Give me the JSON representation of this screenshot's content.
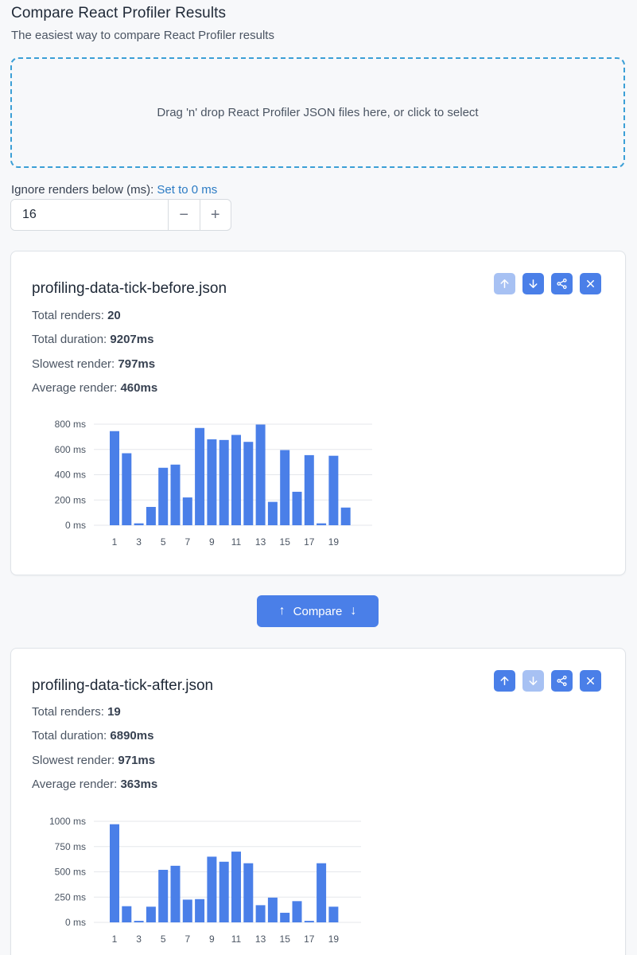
{
  "header": {
    "title": "Compare React Profiler Results",
    "subtitle": "The easiest way to compare React Profiler results"
  },
  "dropzone": {
    "text": "Drag 'n' drop React Profiler JSON files here, or click to select"
  },
  "threshold": {
    "label": "Ignore renders below (ms):",
    "reset_link": "Set to 0 ms",
    "value": "16",
    "minus": "−",
    "plus": "+"
  },
  "compare_button": {
    "label": "Compare",
    "icons": [
      "arrow-up-icon",
      "arrow-down-icon"
    ]
  },
  "colors": {
    "accent": "#4a7fe8",
    "accent_disabled": "#a7c1f3",
    "dropzone_border": "#3b9fd6",
    "link": "#2b7bc4"
  },
  "cards": [
    {
      "filename": "profiling-data-tick-before.json",
      "stats": [
        {
          "label": "Total renders:",
          "value": "20"
        },
        {
          "label": "Total duration:",
          "value": "9207ms"
        },
        {
          "label": "Slowest render:",
          "value": "797ms"
        },
        {
          "label": "Average render:",
          "value": "460ms"
        }
      ],
      "actions": [
        {
          "icon": "arrow-up-icon",
          "disabled": true
        },
        {
          "icon": "arrow-down-icon",
          "disabled": false
        },
        {
          "icon": "share-icon",
          "disabled": false
        },
        {
          "icon": "close-icon",
          "disabled": false
        }
      ]
    },
    {
      "filename": "profiling-data-tick-after.json",
      "stats": [
        {
          "label": "Total renders:",
          "value": "19"
        },
        {
          "label": "Total duration:",
          "value": "6890ms"
        },
        {
          "label": "Slowest render:",
          "value": "971ms"
        },
        {
          "label": "Average render:",
          "value": "363ms"
        }
      ],
      "actions": [
        {
          "icon": "arrow-up-icon",
          "disabled": false
        },
        {
          "icon": "arrow-down-icon",
          "disabled": true
        },
        {
          "icon": "share-icon",
          "disabled": false
        },
        {
          "icon": "close-icon",
          "disabled": false
        }
      ]
    }
  ],
  "chart_data": [
    {
      "type": "bar",
      "categories": [
        "1",
        "2",
        "3",
        "4",
        "5",
        "6",
        "7",
        "8",
        "9",
        "10",
        "11",
        "12",
        "13",
        "14",
        "15",
        "16",
        "17",
        "18",
        "19",
        "20"
      ],
      "tick_labels": [
        "1",
        "3",
        "5",
        "7",
        "9",
        "11",
        "13",
        "15",
        "17",
        "19"
      ],
      "values": [
        745,
        570,
        15,
        145,
        455,
        480,
        220,
        770,
        680,
        675,
        715,
        660,
        797,
        185,
        595,
        265,
        555,
        15,
        550,
        140
      ],
      "yticks": [
        0,
        200,
        400,
        600,
        800
      ],
      "ytick_labels": [
        "0 ms",
        "200 ms",
        "400 ms",
        "600 ms",
        "800 ms"
      ],
      "ylim": [
        0,
        800
      ],
      "grid": true,
      "color": "#4a7fe8"
    },
    {
      "type": "bar",
      "categories": [
        "1",
        "2",
        "3",
        "4",
        "5",
        "6",
        "7",
        "8",
        "9",
        "10",
        "11",
        "12",
        "13",
        "14",
        "15",
        "16",
        "17",
        "18",
        "19"
      ],
      "tick_labels": [
        "1",
        "3",
        "5",
        "7",
        "9",
        "11",
        "13",
        "15",
        "17",
        "19"
      ],
      "values": [
        971,
        160,
        15,
        155,
        520,
        560,
        225,
        230,
        650,
        600,
        700,
        585,
        170,
        245,
        95,
        210,
        15,
        585,
        155
      ],
      "yticks": [
        0,
        250,
        500,
        750,
        1000
      ],
      "ytick_labels": [
        "0 ms",
        "250 ms",
        "500 ms",
        "750 ms",
        "1000 ms"
      ],
      "ylim": [
        0,
        1000
      ],
      "grid": true,
      "color": "#4a7fe8"
    }
  ]
}
